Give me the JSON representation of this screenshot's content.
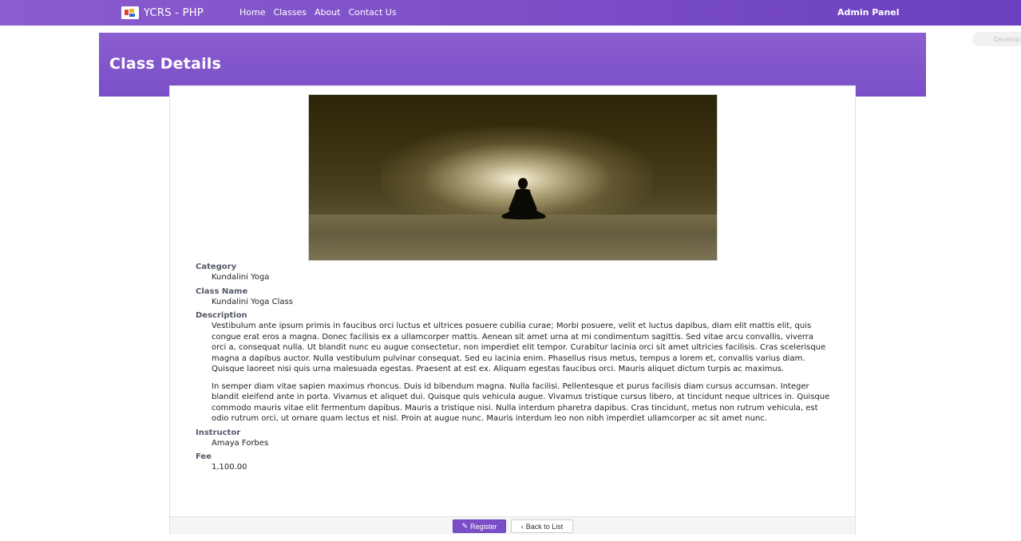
{
  "navbar": {
    "brand": "YCRS - PHP",
    "links": [
      "Home",
      "Classes",
      "About",
      "Contact Us"
    ],
    "admin": "Admin Panel"
  },
  "header": {
    "title": "Class Details"
  },
  "side_pill": "Develop",
  "details": {
    "category_label": "Category",
    "category": "Kundalini Yoga",
    "class_name_label": "Class Name",
    "class_name": "Kundalini Yoga Class",
    "description_label": "Description",
    "description_p1": "Vestibulum ante ipsum primis in faucibus orci luctus et ultrices posuere cubilia curae; Morbi posuere, velit et luctus dapibus, diam elit mattis elit, quis congue erat eros a magna. Donec facilisis ex a ullamcorper mattis. Aenean sit amet urna at mi condimentum sagittis. Sed vitae arcu convallis, viverra orci a, consequat nulla. Ut blandit nunc eu augue consectetur, non imperdiet elit tempor. Curabitur lacinia orci sit amet ultricies facilisis. Cras scelerisque magna a dapibus auctor. Nulla vestibulum pulvinar consequat. Sed eu lacinia enim. Phasellus risus metus, tempus a lorem et, convallis varius diam. Quisque laoreet nisi quis urna malesuada egestas. Praesent at est ex. Aliquam egestas faucibus orci. Mauris aliquet dictum turpis ac maximus.",
    "description_p2": "In semper diam vitae sapien maximus rhoncus. Duis id bibendum magna. Nulla facilisi. Pellentesque et purus facilisis diam cursus accumsan. Integer blandit eleifend ante in porta. Vivamus et aliquet dui. Quisque quis vehicula augue. Vivamus tristique cursus libero, at tincidunt neque ultrices in. Quisque commodo mauris vitae elit fermentum dapibus. Mauris a tristique nisi. Nulla interdum pharetra dapibus. Cras tincidunt, metus non rutrum vehicula, est odio rutrum orci, ut ornare quam lectus et nisl. Proin at augue nunc. Mauris interdum leo non nibh imperdiet ullamcorper ac sit amet nunc.",
    "instructor_label": "Instructor",
    "instructor": "Amaya Forbes",
    "fee_label": "Fee",
    "fee": "1,100.00"
  },
  "footer": {
    "register_label": "Register",
    "back_label": "Back to List"
  },
  "icons": {
    "brand": "brand-logo-icon",
    "register": "pen-icon",
    "back": "angle-left-icon"
  },
  "colors": {
    "primary": "#7a4ec6",
    "navbar_start": "#8a5ccf",
    "navbar_end": "#6b3fbf"
  }
}
